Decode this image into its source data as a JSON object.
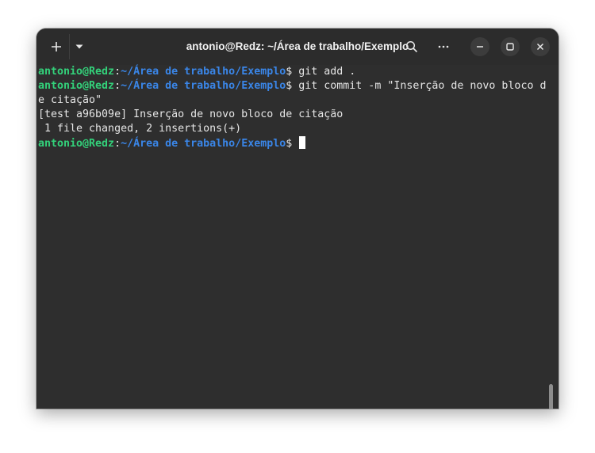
{
  "window": {
    "title": "antonio@Redz: ~/Área de trabalho/Exemplo"
  },
  "toolbar": {
    "new_tab_icon": "plus-icon",
    "menu_icon": "caret-down-icon",
    "search_icon": "search-icon",
    "more_icon": "ellipsis-icon",
    "minimize_icon": "minimize-icon",
    "maximize_icon": "maximize-icon",
    "close_icon": "close-icon"
  },
  "terminal": {
    "prompt": {
      "user_host": "antonio@Redz",
      "colon": ":",
      "path": "~/Área de trabalho/Exemplo",
      "dollar": "$ "
    },
    "lines": [
      {
        "type": "prompt",
        "command": "git add ."
      },
      {
        "type": "prompt",
        "command": "git commit -m \"Inserção de novo bloco d"
      },
      {
        "type": "output",
        "text": "e citação\""
      },
      {
        "type": "output",
        "text": "[test a96b09e] Inserção de novo bloco de citação"
      },
      {
        "type": "output",
        "text": " 1 file changed, 2 insertions(+)"
      },
      {
        "type": "prompt",
        "command": ""
      }
    ]
  },
  "colors": {
    "user_host": "#33d17a",
    "path": "#3a86e8",
    "text": "#e6e6e6",
    "background": "#2e2e2e"
  }
}
